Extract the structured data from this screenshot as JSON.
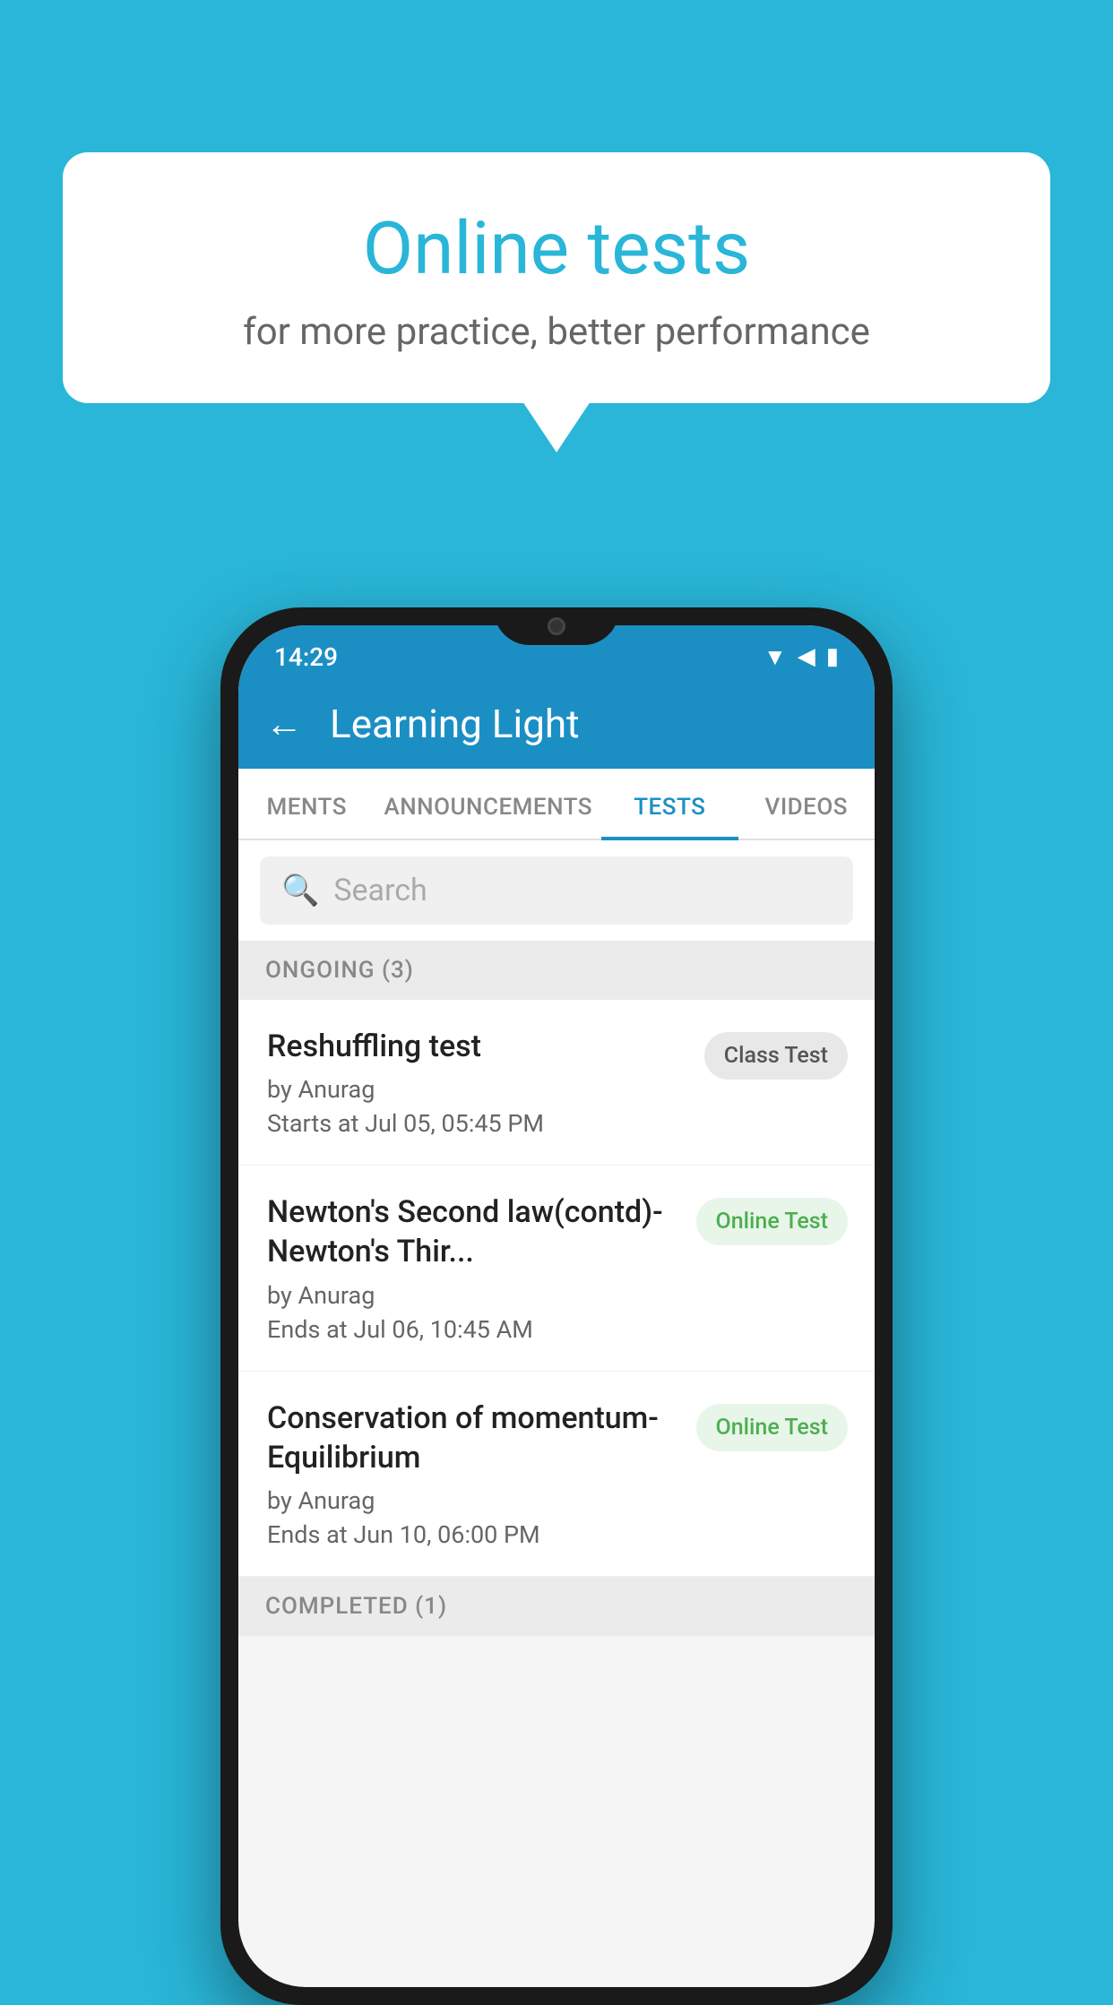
{
  "background": {
    "color": "#29b6d8"
  },
  "speechBubble": {
    "title": "Online tests",
    "subtitle": "for more practice, better performance"
  },
  "phone": {
    "statusBar": {
      "time": "14:29",
      "icons": [
        "wifi",
        "signal",
        "battery"
      ]
    },
    "appBar": {
      "title": "Learning Light",
      "backLabel": "←"
    },
    "tabs": [
      {
        "label": "MENTS",
        "active": false
      },
      {
        "label": "ANNOUNCEMENTS",
        "active": false
      },
      {
        "label": "TESTS",
        "active": true
      },
      {
        "label": "VIDEOS",
        "active": false
      }
    ],
    "search": {
      "placeholder": "Search"
    },
    "ongoingSection": {
      "label": "ONGOING (3)"
    },
    "tests": [
      {
        "name": "Reshuffling test",
        "author": "by Anurag",
        "dateLabel": "Starts at",
        "date": "Jul 05, 05:45 PM",
        "badge": "Class Test",
        "badgeType": "class"
      },
      {
        "name": "Newton's Second law(contd)-Newton's Thir...",
        "author": "by Anurag",
        "dateLabel": "Ends at",
        "date": "Jul 06, 10:45 AM",
        "badge": "Online Test",
        "badgeType": "online"
      },
      {
        "name": "Conservation of momentum-Equilibrium",
        "author": "by Anurag",
        "dateLabel": "Ends at",
        "date": "Jun 10, 06:00 PM",
        "badge": "Online Test",
        "badgeType": "online"
      }
    ],
    "completedSection": {
      "label": "COMPLETED (1)"
    }
  }
}
